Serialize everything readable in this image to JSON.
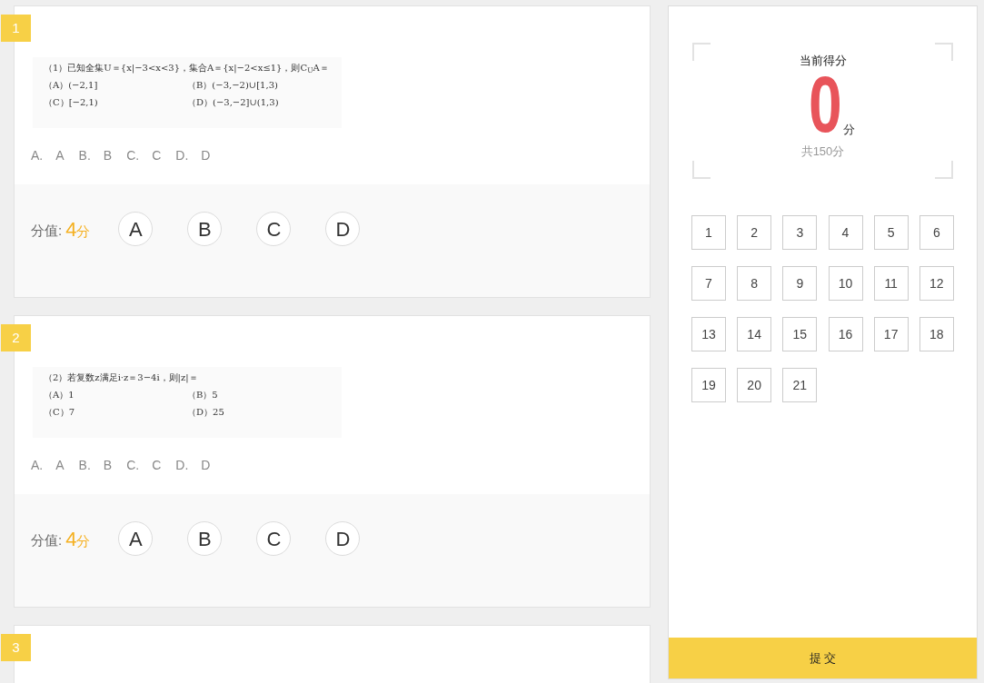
{
  "questions": [
    {
      "number": "1",
      "image": {
        "stem": "（1）已知全集U＝{x|−3<x<3}，集合A＝{x|−2<x≤1}，则C$_{U}$A＝",
        "options": [
          [
            "（A）(−2,1]",
            "（B）(−3,−2)∪[1,3)"
          ],
          [
            "（C）[−2,1)",
            "（D）(−3,−2]∪(1,3)"
          ]
        ]
      },
      "answer_options": [
        {
          "letter": "A.",
          "text": "A"
        },
        {
          "letter": "B.",
          "text": "B"
        },
        {
          "letter": "C.",
          "text": "C"
        },
        {
          "letter": "D.",
          "text": "D"
        }
      ],
      "score_label": "分值:",
      "points": "4",
      "points_unit": "分",
      "choices": [
        {
          "label": "A",
          "selected": false
        },
        {
          "label": "B",
          "selected": false
        },
        {
          "label": "C",
          "selected": false
        },
        {
          "label": "D",
          "selected": false
        }
      ]
    },
    {
      "number": "2",
      "image": {
        "stem": "（2）若复数z满足i·z＝3−4i，则|z|＝",
        "options": [
          [
            "（A）1",
            "（B）5"
          ],
          [
            "（C）7",
            "（D）25"
          ]
        ]
      },
      "answer_options": [
        {
          "letter": "A.",
          "text": "A"
        },
        {
          "letter": "B.",
          "text": "B"
        },
        {
          "letter": "C.",
          "text": "C"
        },
        {
          "letter": "D.",
          "text": "D"
        }
      ],
      "score_label": "分值:",
      "points": "4",
      "points_unit": "分",
      "choices": [
        {
          "label": "A",
          "selected": false
        },
        {
          "label": "B",
          "selected": false
        },
        {
          "label": "C",
          "selected": false
        },
        {
          "label": "D",
          "selected": false
        }
      ]
    },
    {
      "number": "3"
    }
  ],
  "score_panel": {
    "title": "当前得分",
    "score": "0",
    "unit": "分",
    "total": "共150分"
  },
  "question_nav": [
    {
      "label": "1"
    },
    {
      "label": "2"
    },
    {
      "label": "3"
    },
    {
      "label": "4"
    },
    {
      "label": "5"
    },
    {
      "label": "6"
    },
    {
      "label": "7"
    },
    {
      "label": "8"
    },
    {
      "label": "9"
    },
    {
      "label": "10"
    },
    {
      "label": "11"
    },
    {
      "label": "12"
    },
    {
      "label": "13"
    },
    {
      "label": "14"
    },
    {
      "label": "15"
    },
    {
      "label": "16"
    },
    {
      "label": "17"
    },
    {
      "label": "18"
    },
    {
      "label": "19"
    },
    {
      "label": "20"
    },
    {
      "label": "21"
    }
  ],
  "submit_button": "提 交"
}
